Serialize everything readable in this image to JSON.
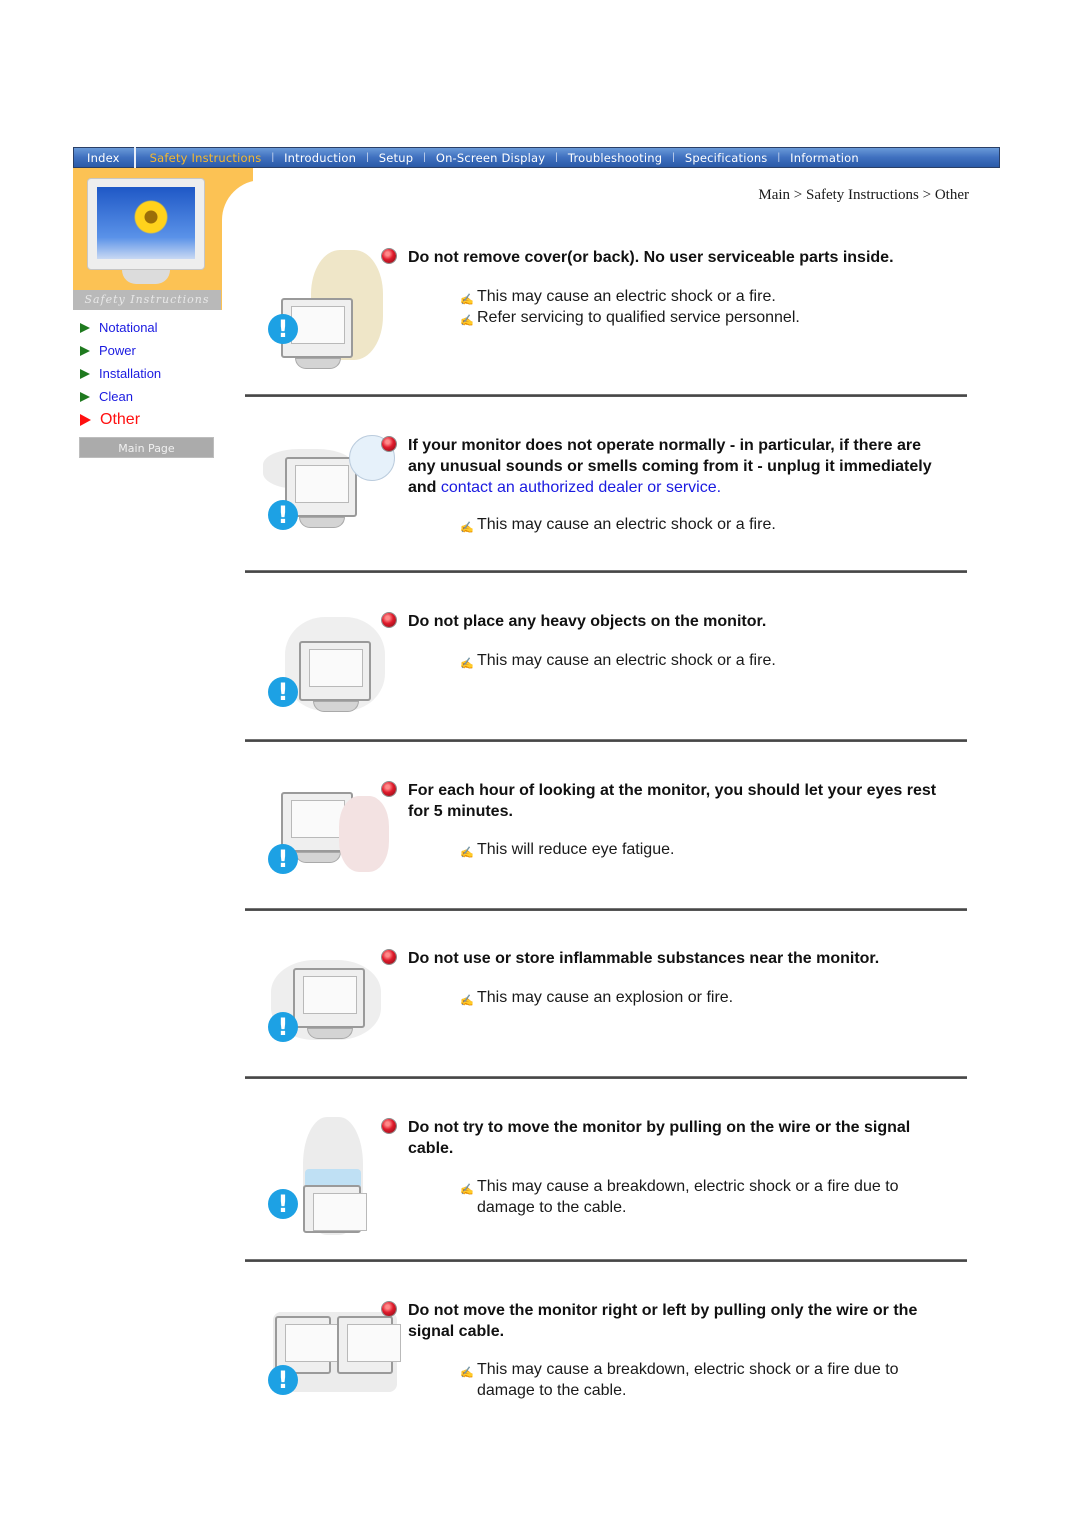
{
  "nav": {
    "items": [
      {
        "label": "Index",
        "active": false
      },
      {
        "label": "Safety Instructions",
        "active": true
      },
      {
        "label": "Introduction",
        "active": false
      },
      {
        "label": "Setup",
        "active": false
      },
      {
        "label": "On-Screen Display",
        "active": false
      },
      {
        "label": "Troubleshooting",
        "active": false
      },
      {
        "label": "Specifications",
        "active": false
      },
      {
        "label": "Information",
        "active": false
      }
    ],
    "active_color": "#f5b82e"
  },
  "sidebar": {
    "caption": "Safety Instructions",
    "items": [
      {
        "label": "Notational",
        "active": false
      },
      {
        "label": "Power",
        "active": false
      },
      {
        "label": "Installation",
        "active": false
      },
      {
        "label": "Clean",
        "active": false
      },
      {
        "label": "Other",
        "active": true
      }
    ],
    "main_page_label": "Main Page",
    "accent_color": "#fcc254"
  },
  "breadcrumb": "Main > Safety Instructions > Other",
  "warnings": [
    {
      "title": "Do not remove cover(or back). No user serviceable parts inside.",
      "notes": [
        "This may cause an electric shock or a fire.",
        "Refer servicing to qualified service personnel."
      ],
      "illustration": "man-opening-monitor-cover"
    },
    {
      "title": "If your monitor does not operate normally - in particular, if there are any unusual sounds or smells coming from it - unplug it immediately and",
      "link": "contact an authorized dealer or service",
      "title_end": ".",
      "notes": [
        "This may cause an electric shock or a fire."
      ],
      "illustration": "smoking-monitor-unplug"
    },
    {
      "title": "Do not place any heavy objects on the monitor.",
      "notes": [
        "This may cause an electric shock or a fire."
      ],
      "illustration": "monitor-with-heavy-objects"
    },
    {
      "title": "For each hour of looking at the monitor, you should let your eyes rest for 5 minutes.",
      "notes": [
        "This will reduce eye fatigue."
      ],
      "illustration": "woman-resting-eyes"
    },
    {
      "title": "Do not use or store inflammable substances near the monitor.",
      "notes": [
        "This may cause an explosion or fire."
      ],
      "illustration": "monitor-near-flammables"
    },
    {
      "title": "Do not try to move the monitor by pulling on the wire or the signal cable.",
      "notes": [
        "This may cause a breakdown, electric shock or a fire due to damage to the cable."
      ],
      "illustration": "monitor-lifted-by-cable"
    },
    {
      "title": "Do not move the monitor right or left by pulling only the wire or the signal cable.",
      "notes": [
        "This may cause a breakdown, electric shock or a fire due to damage to the cable."
      ],
      "illustration": "monitor-dragged-by-cable"
    }
  ],
  "icons": {
    "bullet": "red-ball-icon",
    "note": "pencil-icon",
    "note_glyph": "✍",
    "warning": "exclamation-icon",
    "warning_glyph": "!"
  }
}
